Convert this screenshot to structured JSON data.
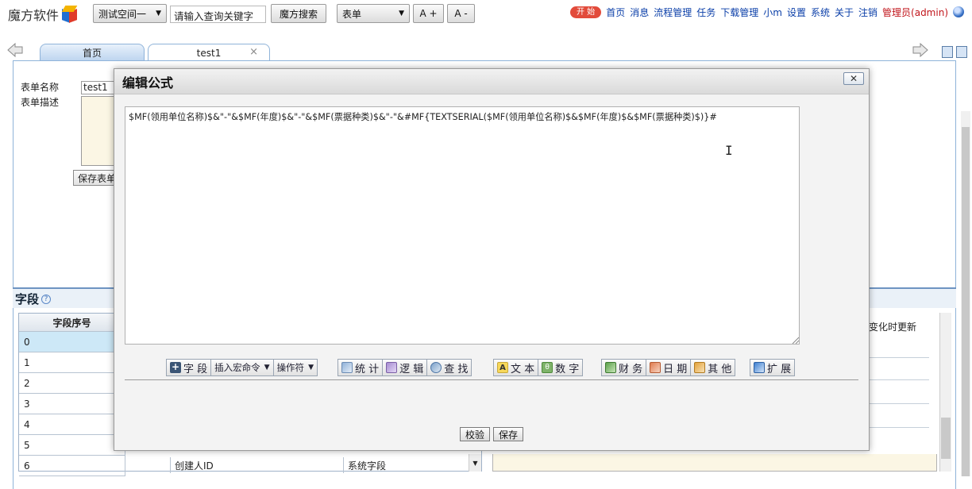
{
  "brand": {
    "name": "魔方软件"
  },
  "toolbar": {
    "workspace_select": "测试空间一",
    "search_placeholder": "请输入查询关键字",
    "search_button": "魔方搜索",
    "type_select": "表单",
    "font_plus": "A +",
    "font_minus": "A -"
  },
  "nav": {
    "start": "开 始",
    "items": [
      "首页",
      "消息",
      "流程管理",
      "任务",
      "下载管理",
      "小m",
      "设置",
      "系统",
      "关于",
      "注销"
    ],
    "user": "管理员(admin)"
  },
  "tabs": [
    {
      "label": "首页"
    },
    {
      "label": "test1",
      "close": "×"
    }
  ],
  "form": {
    "name_label": "表单名称",
    "name_value": "test1",
    "desc_label": "表单描述",
    "save_button": "保存表单"
  },
  "fields": {
    "title": "字段",
    "help": "?",
    "column_header": "字段序号",
    "rows": [
      "0",
      "1",
      "2",
      "3",
      "4",
      "5",
      "6"
    ],
    "row6_name": "创建人ID",
    "row6_type": "系统字段",
    "right_column_text": "变化时更新"
  },
  "modal": {
    "title": "编辑公式",
    "close": "✕",
    "formula": "$MF(领用单位名称)$&\"-\"&$MF(年度)$&\"-\"&$MF(票据种类)$&\"-\"&#MF{TEXTSERIAL($MF(领用单位名称)$&$MF(年度)$&$MF(票据种类)$)}#",
    "buttons": {
      "field": "字 段",
      "insert_macro": "插入宏命令",
      "operator": "操作符",
      "stats": "统 计",
      "logic": "逻 辑",
      "find": "查 找",
      "text": "文 本",
      "number": "数 字",
      "finance": "财 务",
      "date": "日 期",
      "other": "其 他",
      "extend": "扩 展"
    },
    "validate": "校验",
    "save": "保存"
  }
}
